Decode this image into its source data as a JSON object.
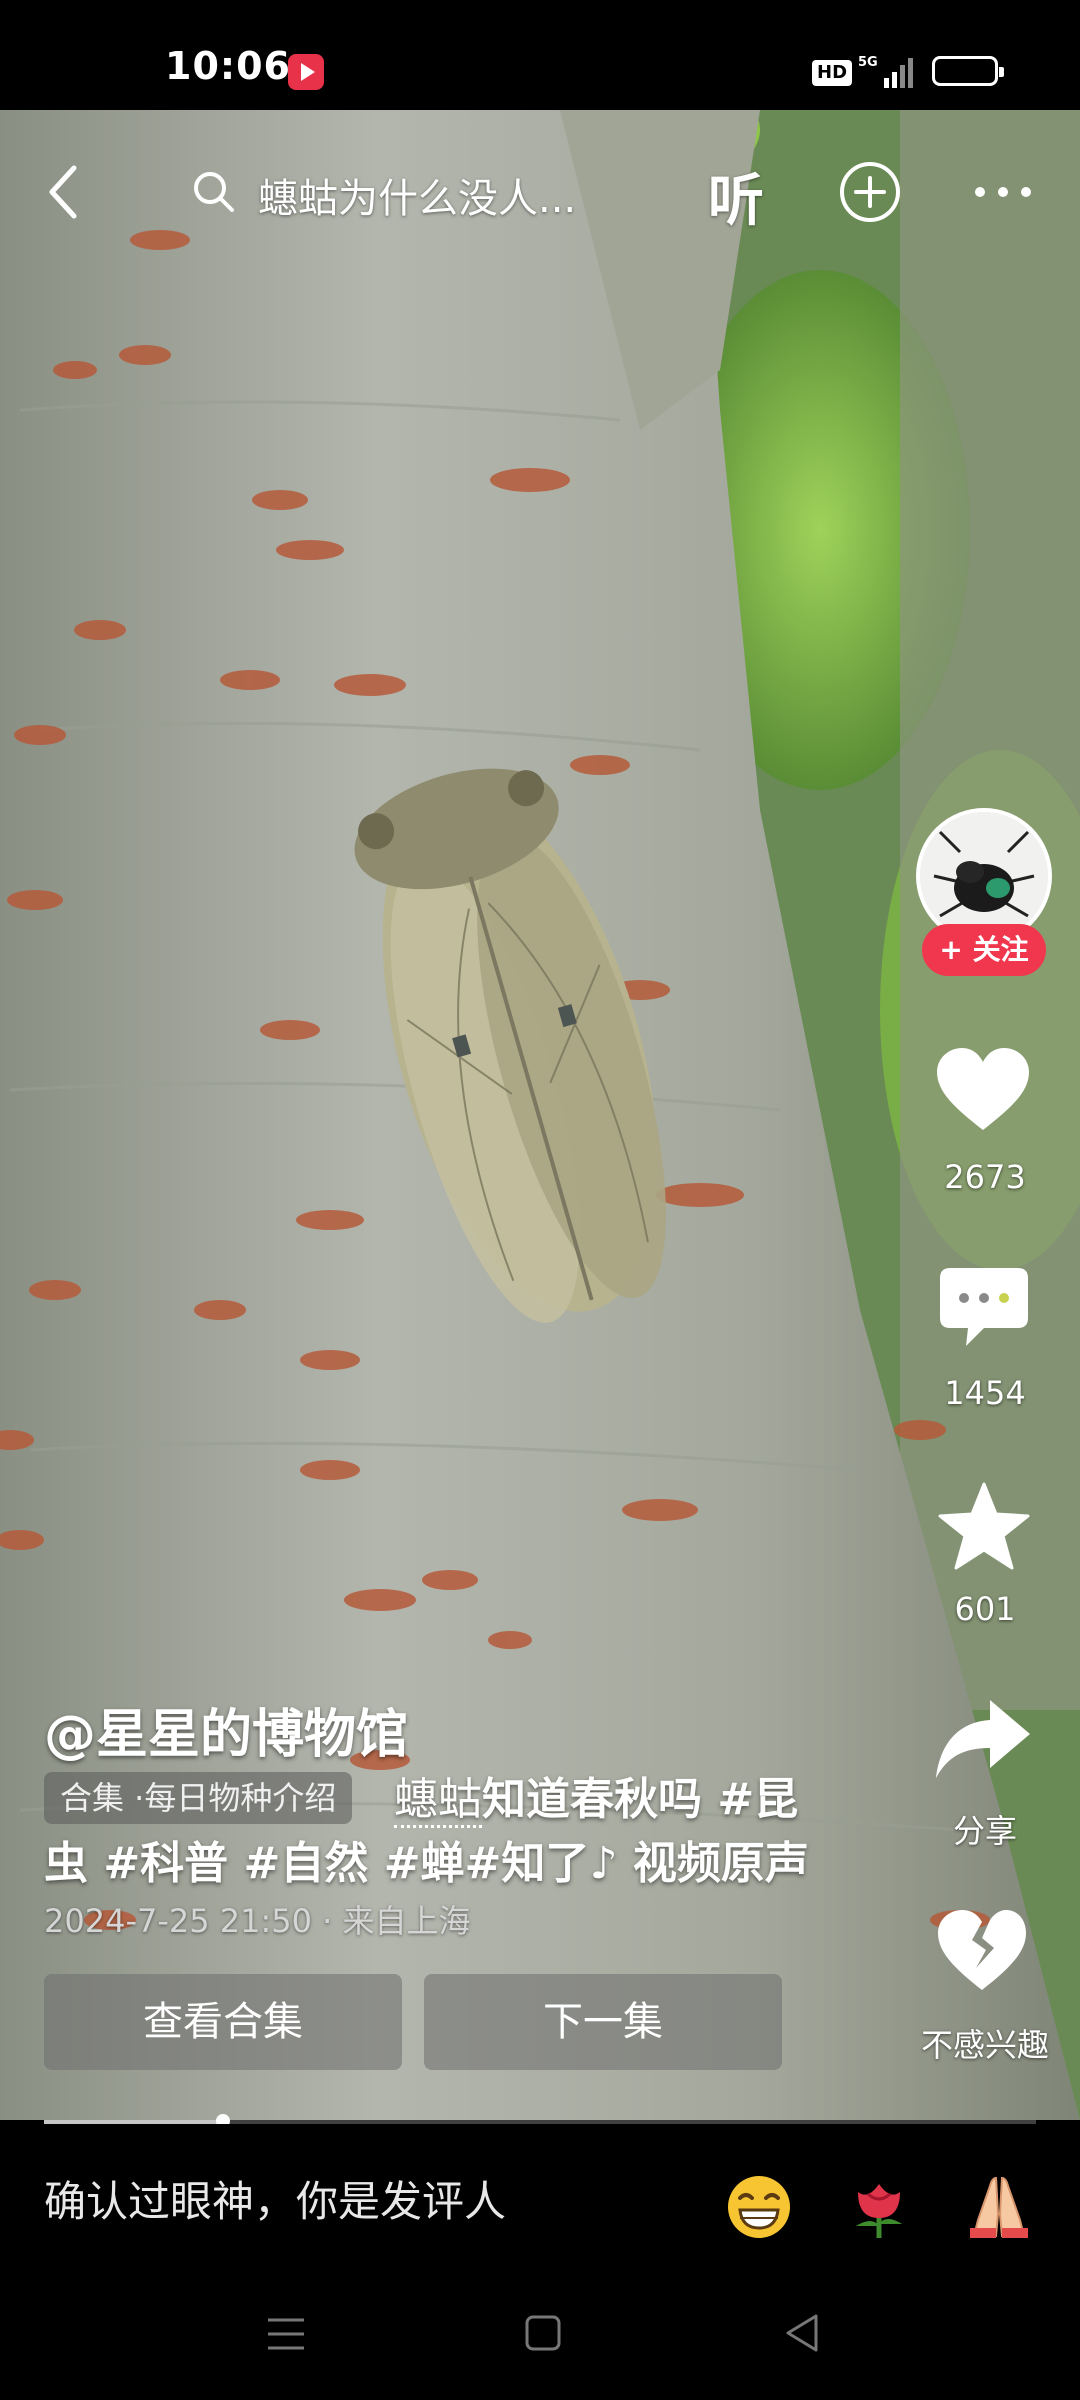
{
  "status_bar": {
    "time": "10:06",
    "hd": "HD",
    "network": "5G"
  },
  "top_nav": {
    "back_icon": "chevron-left-icon",
    "search_icon": "search-icon",
    "search_text": "蟪蛄为什么没人...",
    "listen_label": "听",
    "add_icon": "plus-circle-icon",
    "more_icon": "more-dots-icon"
  },
  "right_rail": {
    "follow_label": "+ 关注",
    "likes": "2673",
    "comments": "1454",
    "favorites": "601",
    "share_label": "分享",
    "dislike_label": "不感兴趣"
  },
  "post": {
    "author": "@星星的博物馆",
    "collection_tag": "合集 ·每日物种介绍",
    "keyword": "蟪蛄",
    "desc_main": "知道春秋吗 #昆虫 #科普 #自然 #蝉#知了",
    "audio": "♪ 视频原声",
    "meta": "2024-7-25 21:50 · 来自上海"
  },
  "actions": {
    "view_collection": "查看合集",
    "next_episode": "下一集"
  },
  "playback": {
    "progress_fraction": 0.18
  },
  "comment_bar": {
    "placeholder": "确认过眼神，你是发评人",
    "emojis": [
      "grinning-face-icon",
      "rose-icon",
      "folded-hands-icon"
    ]
  },
  "colors": {
    "follow_red": "#f0374e",
    "record_red": "#e8324a"
  }
}
